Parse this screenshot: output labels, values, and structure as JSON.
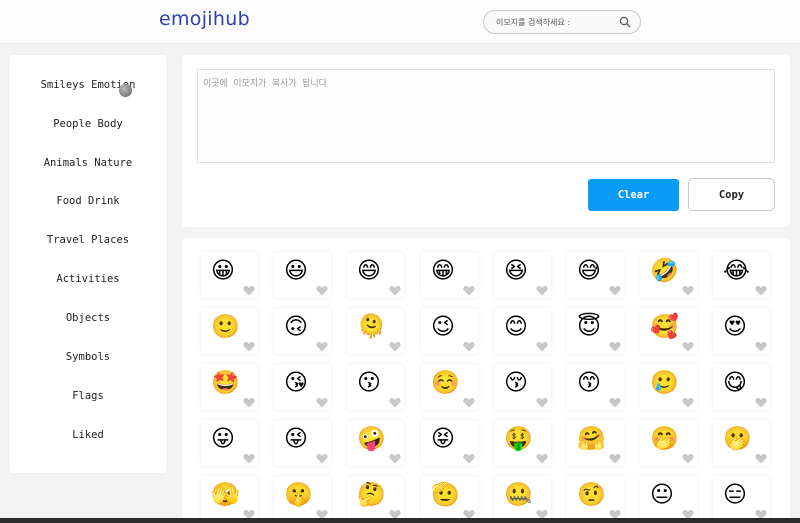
{
  "header": {
    "logo": "emojihub",
    "search": {
      "placeholder": "이모지를 검색하세요 :",
      "icon": "search-icon"
    }
  },
  "sidebar": {
    "items": [
      {
        "label": "Smileys Emotion",
        "id": "smileys-emotion"
      },
      {
        "label": "People Body",
        "id": "people-body"
      },
      {
        "label": "Animals Nature",
        "id": "animals-nature"
      },
      {
        "label": "Food Drink",
        "id": "food-drink"
      },
      {
        "label": "Travel Places",
        "id": "travel-places"
      },
      {
        "label": "Activities",
        "id": "activities"
      },
      {
        "label": "Objects",
        "id": "objects"
      },
      {
        "label": "Symbols",
        "id": "symbols"
      },
      {
        "label": "Flags",
        "id": "flags"
      },
      {
        "label": "Liked",
        "id": "liked"
      }
    ]
  },
  "editor": {
    "placeholder": "이곳에 이모지가 복사가 됩니다",
    "value": "",
    "clear_label": "Clear",
    "copy_label": "Copy",
    "clear_color": "#0a9bf6"
  },
  "emoji_grid": {
    "like_icon": "heart-icon",
    "heart_color": "#c8c8c8",
    "rows": [
      [
        "😀",
        "😃",
        "😄",
        "😁",
        "😆",
        "😅",
        "🤣",
        "😂"
      ],
      [
        "🙂",
        "🙃",
        "🫠",
        "😉",
        "😊",
        "😇",
        "🥰",
        "😍"
      ],
      [
        "🤩",
        "😘",
        "😗",
        "☺️",
        "😚",
        "😙",
        "🥲",
        "😋"
      ],
      [
        "😛",
        "😜",
        "🤪",
        "😝",
        "🤑",
        "🤗",
        "🤭",
        "🫢"
      ],
      [
        "🫣",
        "🤫",
        "🤔",
        "🫡",
        "🤐",
        "🤨",
        "😐",
        "😑"
      ]
    ]
  }
}
